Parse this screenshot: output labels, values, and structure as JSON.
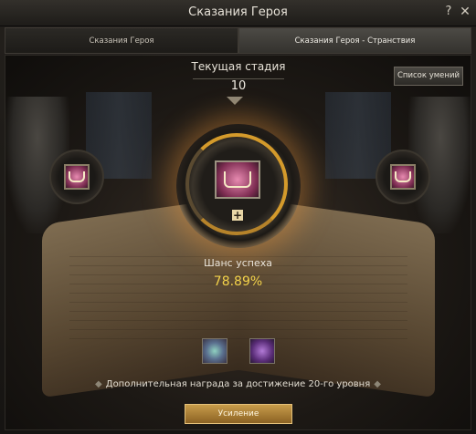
{
  "window": {
    "title": "Сказания Героя",
    "help_label": "?",
    "close_label": "✕"
  },
  "tabs": [
    {
      "label": "Сказания Героя",
      "active": false
    },
    {
      "label": "Сказания Героя - Странствия",
      "active": true
    }
  ],
  "stage": {
    "label": "Текущая стадия",
    "value": "10"
  },
  "skill_list_button": "Список умений",
  "slots": {
    "left_icon": "book-icon",
    "center_icon": "book-icon",
    "right_icon": "book-icon",
    "add_label": "+"
  },
  "success": {
    "label": "Шанс успеха",
    "value": "78.89%"
  },
  "reward": {
    "text": "Дополнительная награда за достижение 20-го уровня",
    "deco": "◆",
    "icons": [
      "crystal-icon",
      "spellbook-icon"
    ]
  },
  "enhance_button": "Усиление",
  "colors": {
    "accent": "#f3d24a",
    "gold": "#d49a2b"
  }
}
